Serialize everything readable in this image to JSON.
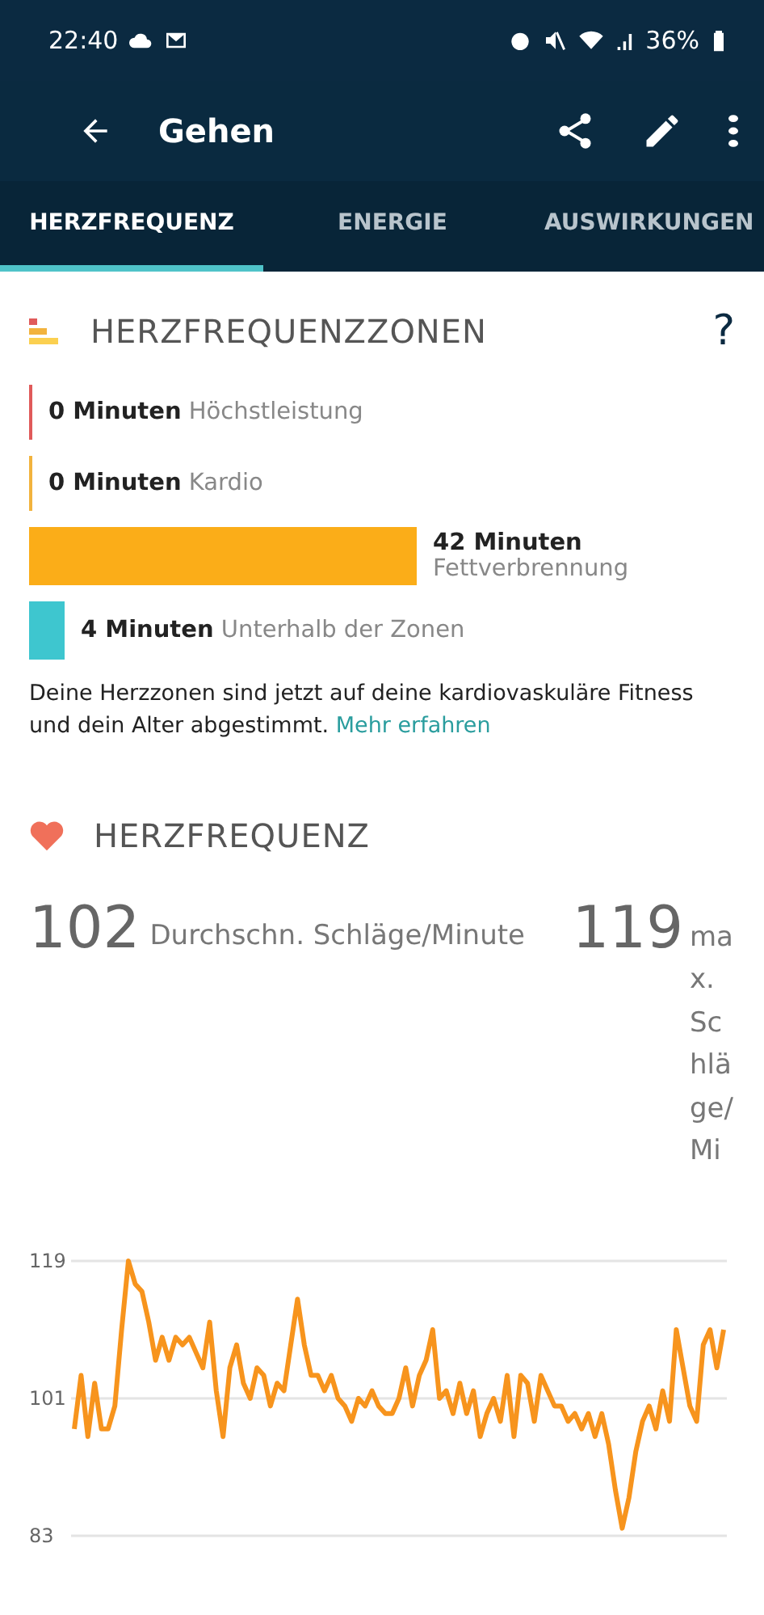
{
  "status_bar": {
    "time": "22:40",
    "battery": "36%"
  },
  "app_bar": {
    "title": "Gehen"
  },
  "tabs": [
    {
      "label": "HERZFREQUENZ",
      "selected": true
    },
    {
      "label": "ENERGIE",
      "selected": false
    },
    {
      "label": "AUSWIRKUNGEN",
      "selected": false
    }
  ],
  "zones_section": {
    "title": "HERZFREQUENZZONEN",
    "help": "?",
    "zones": [
      {
        "kind": "line",
        "minutes": "0 Minuten",
        "label": "Höchstleistung",
        "color": "#e05a5a"
      },
      {
        "kind": "line",
        "minutes": "0 Minuten",
        "label": "Kardio",
        "color": "#f2b33d"
      },
      {
        "kind": "bar",
        "minutes": "42 Minuten",
        "label": "Fettverbrennung",
        "color": "#fbad18"
      },
      {
        "kind": "block",
        "minutes": "4 Minuten",
        "label": "Unterhalb der Zonen",
        "color": "#3ec6cf"
      }
    ],
    "note": "Deine Herzzonen sind jetzt auf deine kardiovaskuläre Fitness und dein Alter abgestimmt.",
    "link": "Mehr erfahren"
  },
  "heart_section": {
    "title": "HERZFREQUENZ",
    "average": "102",
    "average_label": "Durchschn. Schläge/Minute",
    "max": "119",
    "max_label": "max. Schläge/Mi",
    "chart_data": {
      "type": "line",
      "ylim": [
        83,
        119
      ],
      "yticks": [
        83,
        101,
        119
      ],
      "series": [
        {
          "color": "#f7941d",
          "values": [
            97,
            104,
            96,
            103,
            97,
            97,
            100,
            110,
            119,
            116,
            115,
            111,
            106,
            109,
            106,
            109,
            108,
            109,
            107,
            105,
            111,
            102,
            96,
            105,
            108,
            103,
            101,
            105,
            104,
            100,
            103,
            102,
            108,
            114,
            108,
            104,
            104,
            102,
            104,
            101,
            100,
            98,
            101,
            100,
            102,
            100,
            99,
            99,
            101,
            105,
            100,
            104,
            106,
            110,
            101,
            102,
            99,
            103,
            99,
            102,
            96,
            99,
            101,
            98,
            104,
            96,
            104,
            103,
            98,
            104,
            102,
            100,
            100,
            98,
            99,
            97,
            99,
            96,
            99,
            95,
            89,
            84,
            88,
            94,
            98,
            100,
            97,
            102,
            98,
            110,
            105,
            100,
            98,
            108,
            110,
            105,
            110
          ]
        }
      ]
    }
  }
}
